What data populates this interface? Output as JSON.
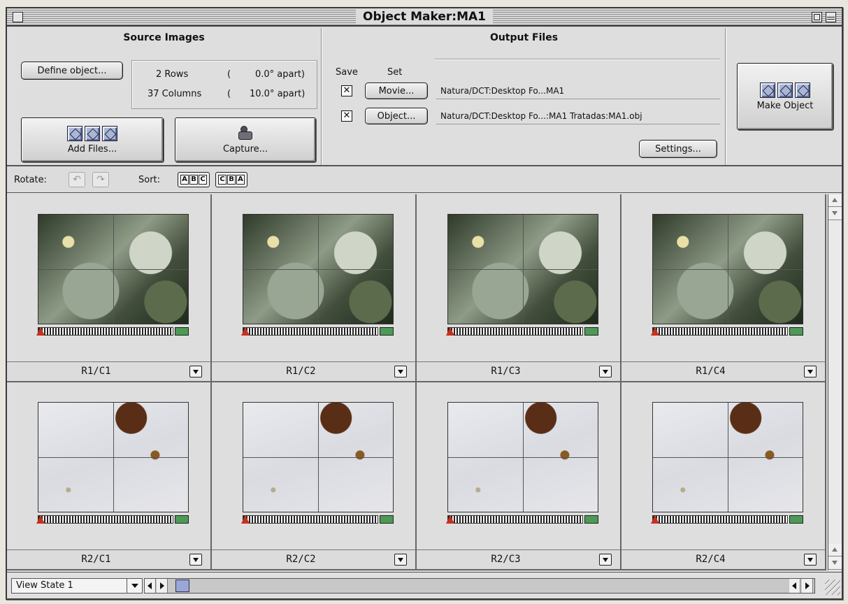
{
  "window": {
    "title": "Object Maker:MA1"
  },
  "source": {
    "title": "Source Images",
    "define_label": "Define object...",
    "rows_label": "2 Rows",
    "rows_apart": "0.0° apart)",
    "cols_label": "37 Columns",
    "cols_apart": "10.0° apart)",
    "paren": "(",
    "add_files_label": "Add Files...",
    "capture_label": "Capture..."
  },
  "output": {
    "title": "Output Files",
    "save_label": "Save",
    "set_label": "Set",
    "movie_button": "Movie...",
    "movie_path": "Natura/DCT:Desktop Fo...MA1",
    "object_button": "Object...",
    "object_path": "Natura/DCT:Desktop Fo...:MA1 Tratadas:MA1.obj",
    "settings_label": "Settings...",
    "check_mark": "✕"
  },
  "make": {
    "label": "Make Object"
  },
  "toolbar": {
    "rotate_label": "Rotate:",
    "sort_label": "Sort:",
    "rotate_ccw": "↶",
    "rotate_cw": "↷",
    "sort_abc": [
      "A",
      "B",
      "C"
    ],
    "sort_cba": [
      "C",
      "B",
      "A"
    ]
  },
  "tiles": [
    {
      "name": "R1/C1",
      "kind": "dark"
    },
    {
      "name": "R1/C2",
      "kind": "dark"
    },
    {
      "name": "R1/C3",
      "kind": "dark"
    },
    {
      "name": "R1/C4",
      "kind": "dark"
    },
    {
      "name": "R2/C1",
      "kind": "light"
    },
    {
      "name": "R2/C2",
      "kind": "light"
    },
    {
      "name": "R2/C3",
      "kind": "light"
    },
    {
      "name": "R2/C4",
      "kind": "light"
    }
  ],
  "bottom": {
    "view_state": "View State 1"
  }
}
